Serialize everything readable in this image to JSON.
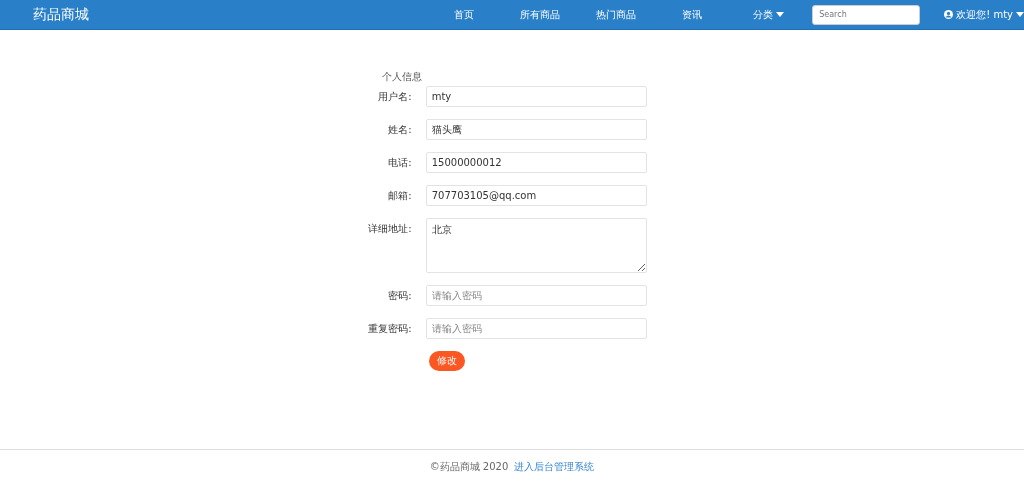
{
  "navbar": {
    "brand": "药品商城",
    "links": [
      {
        "label": "首页",
        "dropdown": false
      },
      {
        "label": "所有商品",
        "dropdown": false
      },
      {
        "label": "热门商品",
        "dropdown": false
      },
      {
        "label": "资讯",
        "dropdown": false
      },
      {
        "label": "分类",
        "dropdown": true
      }
    ],
    "search": {
      "placeholder": "Search"
    },
    "user": {
      "label": "欢迎您! mty",
      "dropdown": true
    }
  },
  "form": {
    "title": "个人信息",
    "fields": [
      {
        "label": "用户名:",
        "kind": "input",
        "value": "mty"
      },
      {
        "label": "姓名:",
        "kind": "input",
        "value": "猫头鹰"
      },
      {
        "label": "电话:",
        "kind": "input",
        "value": "15000000012"
      },
      {
        "label": "邮箱:",
        "kind": "input",
        "value": "707703105@qq.com"
      },
      {
        "label": "详细地址:",
        "kind": "textarea",
        "value": "北京"
      },
      {
        "label": "密码:",
        "kind": "password",
        "placeholder": "请输入密码"
      },
      {
        "label": "重复密码:",
        "kind": "password",
        "placeholder": "请输入密码"
      }
    ],
    "submit": "修改"
  },
  "footer": {
    "copyright": "©药品商城 2020",
    "link": "进入后台管理系统"
  }
}
